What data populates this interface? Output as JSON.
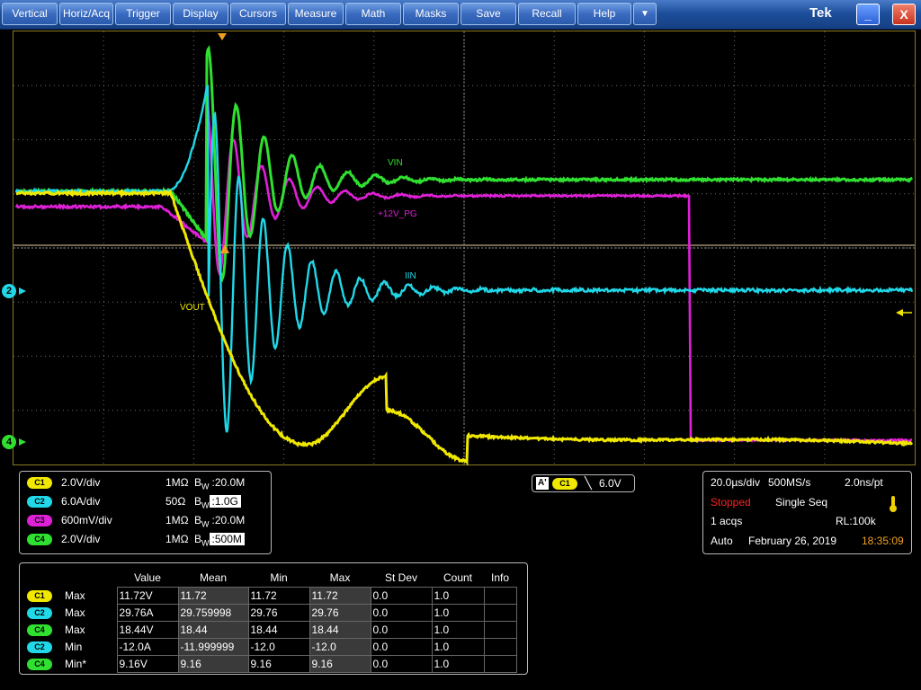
{
  "menu": {
    "items": [
      "Vertical",
      "Horiz/Acq",
      "Trigger",
      "Display",
      "Cursors",
      "Measure",
      "Math",
      "Masks",
      "Save",
      "Recall",
      "Help"
    ],
    "dropdown_glyph": "▼",
    "logo": "Tek",
    "minimize_glyph": "_",
    "close_glyph": "X"
  },
  "waveforms": {
    "labels": {
      "vin": "VIN",
      "pg": "+12V_PG",
      "iin": "IIN",
      "vout": "VOUT"
    },
    "ch2_marker": "2",
    "ch4_marker": "4"
  },
  "colors": {
    "ch1_yellow": "#f0e800",
    "ch2_cyan": "#20d8e8",
    "ch3_magenta": "#e020d8",
    "ch4_green": "#30e030",
    "trigger_orange": "#f0a020"
  },
  "channels": [
    {
      "badge": "C1",
      "scale": "2.0V/div",
      "impedance": "1MΩ",
      "bw_prefix": "B",
      "bw_sub": "W",
      "bw": ":20.0M",
      "boxed": false
    },
    {
      "badge": "C2",
      "scale": "6.0A/div",
      "impedance": "50Ω",
      "bw_prefix": "B",
      "bw_sub": "W",
      "bw": ":1.0G",
      "boxed": true
    },
    {
      "badge": "C3",
      "scale": "600mV/div",
      "impedance": "1MΩ",
      "bw_prefix": "B",
      "bw_sub": "W",
      "bw": ":20.0M",
      "boxed": false
    },
    {
      "badge": "C4",
      "scale": "2.0V/div",
      "impedance": "1MΩ",
      "bw_prefix": "B",
      "bw_sub": "W",
      "bw": ":500M",
      "boxed": true
    }
  ],
  "trigger": {
    "source_tag": "A'",
    "source_badge": "C1",
    "slope_glyph": "╲",
    "level": "6.0V"
  },
  "acquisition": {
    "timebase": "20.0µs/div",
    "sample_rate": "500MS/s",
    "resolution": "2.0ns/pt",
    "state": "Stopped",
    "mode": "Single Seq",
    "acqs": "1 acqs",
    "record_length": "RL:100k",
    "trigger_mode": "Auto",
    "date": "February 26, 2019",
    "time": "18:35:09"
  },
  "measurements": {
    "headers": [
      "Value",
      "Mean",
      "Min",
      "Max",
      "St Dev",
      "Count",
      "Info"
    ],
    "rows": [
      {
        "badge": "C1",
        "type": "Max",
        "value": "11.72V",
        "mean": "11.72",
        "min": "11.72",
        "max": "11.72",
        "stdev": "0.0",
        "count": "1.0",
        "info": ""
      },
      {
        "badge": "C2",
        "type": "Max",
        "value": "29.76A",
        "mean": "29.759998",
        "min": "29.76",
        "max": "29.76",
        "stdev": "0.0",
        "count": "1.0",
        "info": ""
      },
      {
        "badge": "C4",
        "type": "Max",
        "value": "18.44V",
        "mean": "18.44",
        "min": "18.44",
        "max": "18.44",
        "stdev": "0.0",
        "count": "1.0",
        "info": ""
      },
      {
        "badge": "C2",
        "type": "Min",
        "value": "-12.0A",
        "mean": "-11.999999",
        "min": "-12.0",
        "max": "-12.0",
        "stdev": "0.0",
        "count": "1.0",
        "info": ""
      },
      {
        "badge": "C4",
        "type": "Min*",
        "value": "9.16V",
        "mean": "9.16",
        "min": "9.16",
        "max": "9.16",
        "stdev": "0.0",
        "count": "1.0",
        "info": ""
      }
    ]
  }
}
